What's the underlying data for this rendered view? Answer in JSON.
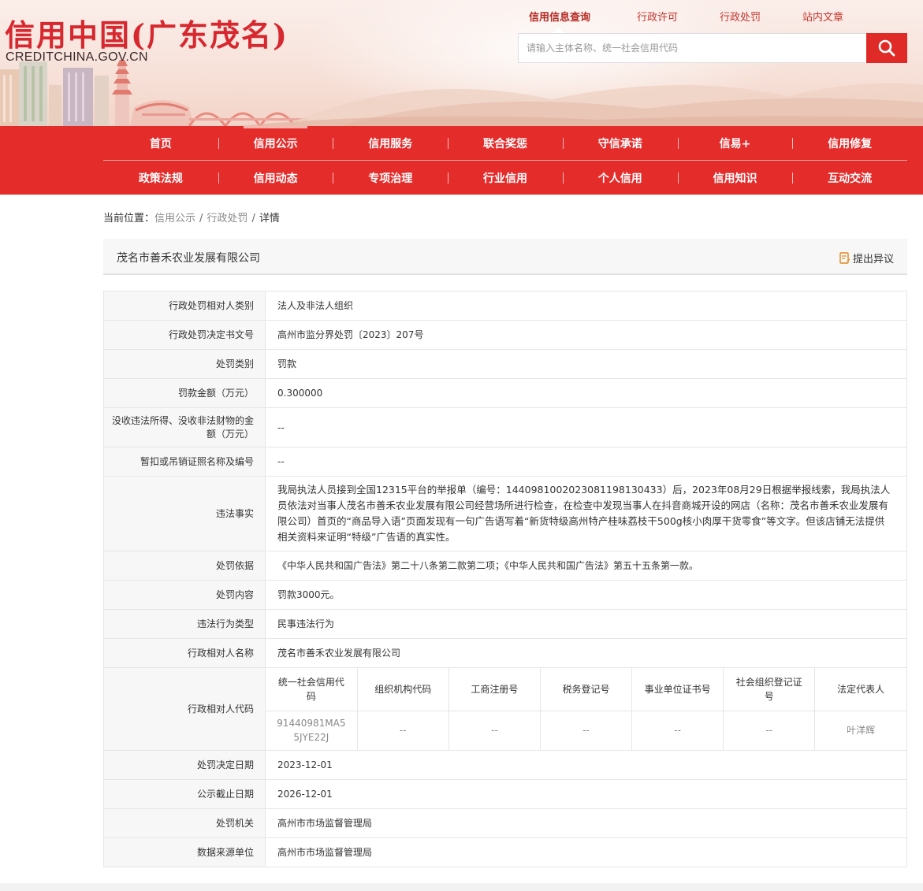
{
  "site": {
    "logo_title": "信用中国(广东茂名)",
    "logo_domain": "CREDITCHINA.GOV.CN"
  },
  "search": {
    "tabs": [
      {
        "label": "信用信息查询",
        "active": true
      },
      {
        "label": "行政许可",
        "active": false
      },
      {
        "label": "行政处罚",
        "active": false
      },
      {
        "label": "站内文章",
        "active": false
      }
    ],
    "placeholder": "请输入主体名称、统一社会信用代码",
    "button_icon": "search-icon"
  },
  "nav": {
    "row1": [
      "首页",
      "信用公示",
      "信用服务",
      "联合奖惩",
      "守信承诺",
      "信易+",
      "信用修复"
    ],
    "row2": [
      "政策法规",
      "信用动态",
      "专项治理",
      "行业信用",
      "个人信用",
      "信用知识",
      "互动交流"
    ],
    "active": "信用公示"
  },
  "breadcrumb": {
    "prefix": "当前位置：",
    "items": [
      "信用公示",
      "行政处罚"
    ],
    "current": "详情",
    "separator": "/"
  },
  "detail": {
    "company": "茂名市善禾农业发展有限公司",
    "objection_label": "提出异议",
    "objection_icon": "objection-icon",
    "fields": [
      {
        "label": "行政处罚相对人类别",
        "value": "法人及非法人组织"
      },
      {
        "label": "行政处罚决定书文号",
        "value": "高州市监分界处罚〔2023〕207号"
      },
      {
        "label": "处罚类别",
        "value": "罚款"
      },
      {
        "label": "罚款金额（万元）",
        "value": "0.300000"
      },
      {
        "label": "没收违法所得、没收非法财物的金额（万元）",
        "value": "--"
      },
      {
        "label": "暂扣或吊销证照名称及编号",
        "value": "--"
      },
      {
        "label": "违法事实",
        "value": "我局执法人员接到全国12315平台的举报单（编号：14409810020230811981304​33）后，2023年08月29日根据举报线索，我局执法人员依法对当事人茂名市善禾农业发展有限公司经营场所进行检查，在检查中发现当事人在抖音商城开设的网店（名称：茂名市善禾农业发展有限公司）首页的“商品导入语”页面发现有一句广告语写着“新货特级高州特产桂味荔枝干500g核小肉厚干货零食”等文字。但该店铺无法提供相关资料来证明“特级”广告语的真实性。"
      },
      {
        "label": "处罚依据",
        "value": "《中华人民共和国广告法》第二十八条第二款第二项；《中华人民共和国广告法》第五十五条第一款。"
      },
      {
        "label": "处罚内容",
        "value": "罚款3000元。"
      },
      {
        "label": "违法行为类型",
        "value": "民事违法行为"
      },
      {
        "label": "行政相对人名称",
        "value": "茂名市善禾农业发展有限公司"
      }
    ],
    "code_label": "行政相对人代码",
    "code_table": {
      "headers": [
        "统一社会信用代码",
        "组织机构代码",
        "工商注册号",
        "税务登记号",
        "事业单位证书号",
        "社会组织登记证号",
        "法定代表人"
      ],
      "values": [
        "91440981MA55JYE22J",
        "--",
        "--",
        "--",
        "--",
        "--",
        "叶洋辉"
      ]
    },
    "fields_after": [
      {
        "label": "处罚决定日期",
        "value": "2023-12-01"
      },
      {
        "label": "公示截止日期",
        "value": "2026-12-01"
      },
      {
        "label": "处罚机关",
        "value": "高州市市场监督管理局"
      },
      {
        "label": "数据来源单位",
        "value": "高州市市场监督管理局"
      }
    ]
  },
  "colors": {
    "brand_red": "#e42c2b",
    "logo_red": "#d7282f",
    "label_bg": "#f7f7f7"
  }
}
